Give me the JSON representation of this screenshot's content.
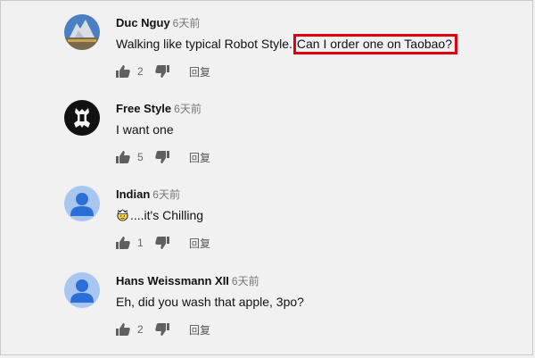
{
  "comments": [
    {
      "author": "Duc Nguy",
      "time": "6天前",
      "text": "Walking like typical Robot Style.",
      "highlight": "Can I order one on Taobao?",
      "likes": "2",
      "reply_label": "回复",
      "avatar_icon": "landscape-photo-avatar"
    },
    {
      "author": "Free Style",
      "time": "6天前",
      "text": "I want one",
      "likes": "5",
      "reply_label": "回复",
      "avatar_icon": "black-logo-avatar"
    },
    {
      "author": "Indian",
      "time": "6天前",
      "text": "....it's Chilling",
      "likes": "1",
      "reply_label": "回复",
      "avatar_icon": "default-person-avatar"
    },
    {
      "author": "Hans Weissmann XII",
      "time": "6天前",
      "text": "Eh, did you wash that apple, 3po?",
      "likes": "2",
      "reply_label": "回复",
      "avatar_icon": "default-person-avatar"
    }
  ],
  "colors": {
    "background": "#f1f1f1",
    "highlight_border": "#e3000f",
    "default_avatar_bg": "#a8c6f0",
    "default_avatar_person": "#2b6fd6"
  }
}
